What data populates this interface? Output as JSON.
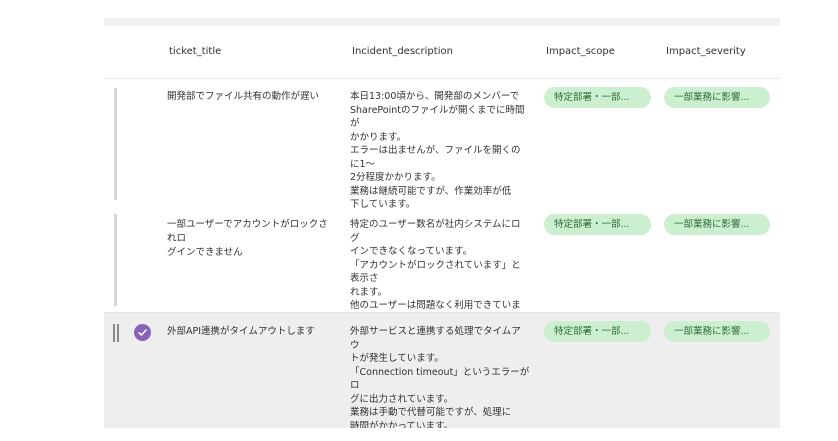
{
  "table": {
    "columns": {
      "title": "ticket_title",
      "description": "Incident_description",
      "scope": "Impact_scope",
      "severity": "Impact_severity"
    },
    "rows": [
      {
        "title": "開発部でファイル共有の動作が遅い",
        "description": "本日13:00頃から、開発部のメンバーで\nSharePointのファイルが開くまでに時間が\nかかります。\nエラーは出ませんが、ファイルを開くのに1〜\n2分程度かかります。\n業務は継続可能ですが、作業効率が低\n下しています。",
        "scope": "特定部署・一部...",
        "severity": "一部業務に影響...",
        "selected": false
      },
      {
        "title": "一部ユーザーでアカウントがロックされロ\nグインできません",
        "description": "特定のユーザー数名が社内システムにログ\nインできなくなっています。\n「アカウントがロックされています」と表示さ\nれます。\n他のユーザーは問題なく利用できていま\nす。",
        "scope": "特定部署・一部...",
        "severity": "一部業務に影響...",
        "selected": false
      },
      {
        "title": "外部API連携がタイムアウトします",
        "description": "外部サービスと連携する処理でタイムアウ\nトが発生しています。\n「Connection timeout」というエラーがロ\nグに出力されています。\n業務は手動で代替可能ですが、処理に\n時間がかかっています。",
        "scope": "特定部署・一部...",
        "severity": "一部業務に影響...",
        "selected": true
      }
    ]
  },
  "colors": {
    "accent": "#8764b8",
    "pill_bg": "#ccefd0",
    "pill_text": "#2e6d35",
    "selected_row": "#eeeeee"
  },
  "icons": {
    "selected": "checkmark-circle-icon",
    "drag": "drag-handle-icon"
  }
}
